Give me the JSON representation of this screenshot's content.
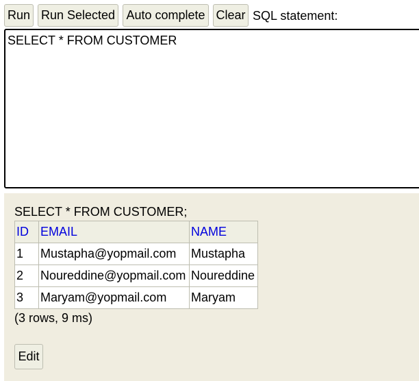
{
  "toolbar": {
    "run_label": "Run",
    "run_selected_label": "Run Selected",
    "autocomplete_label": "Auto complete",
    "clear_label": "Clear",
    "sql_statement_label": "SQL statement:"
  },
  "editor": {
    "value": "SELECT * FROM CUSTOMER"
  },
  "results": {
    "statement": "SELECT * FROM CUSTOMER;",
    "columns": [
      "ID",
      "EMAIL",
      "NAME"
    ],
    "rows": [
      [
        "1",
        "Mustapha@yopmail.com",
        "Mustapha"
      ],
      [
        "2",
        "Noureddine@yopmail.com",
        "Noureddine"
      ],
      [
        "3",
        "Maryam@yopmail.com",
        "Maryam"
      ]
    ],
    "summary": "(3 rows, 9 ms)",
    "edit_label": "Edit"
  },
  "colors": {
    "button_bg": "#efefe3",
    "results_bg": "#f0ede0",
    "header_text": "#0000dd"
  }
}
